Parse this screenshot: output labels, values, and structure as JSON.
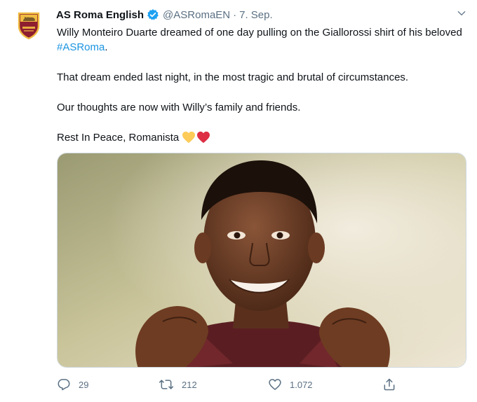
{
  "tweet": {
    "author_name": "AS Roma English",
    "verified": true,
    "handle": "@ASRomaEN",
    "separator": "·",
    "date": "7. Sep.",
    "text": {
      "p1_before": "Willy Monteiro Duarte dreamed of one day pulling on the Giallorossi shirt of his beloved ",
      "p1_hashtag": "#ASRoma",
      "p1_after": ".",
      "p2": "That dream ended last night, in the most tragic and brutal of circumstances.",
      "p3": "Our thoughts are now with Willy’s family and friends.",
      "p4": "Rest In Peace, Romanista"
    },
    "emojis": [
      "yellow-heart",
      "red-heart"
    ]
  },
  "actions": {
    "replies": "29",
    "retweets": "212",
    "likes": "1.072"
  },
  "colors": {
    "secondary_text": "#5b7083",
    "link": "#1b95e0",
    "verified": "#1da1f2",
    "roma_red": "#8e1f2f",
    "roma_gold": "#f0bc42"
  },
  "icons": {
    "avatar": "as-roma-crest",
    "verified": "verified-badge-icon",
    "caret": "chevron-down-icon",
    "reply": "reply-icon",
    "retweet": "retweet-icon",
    "like": "heart-icon",
    "share": "share-icon"
  }
}
